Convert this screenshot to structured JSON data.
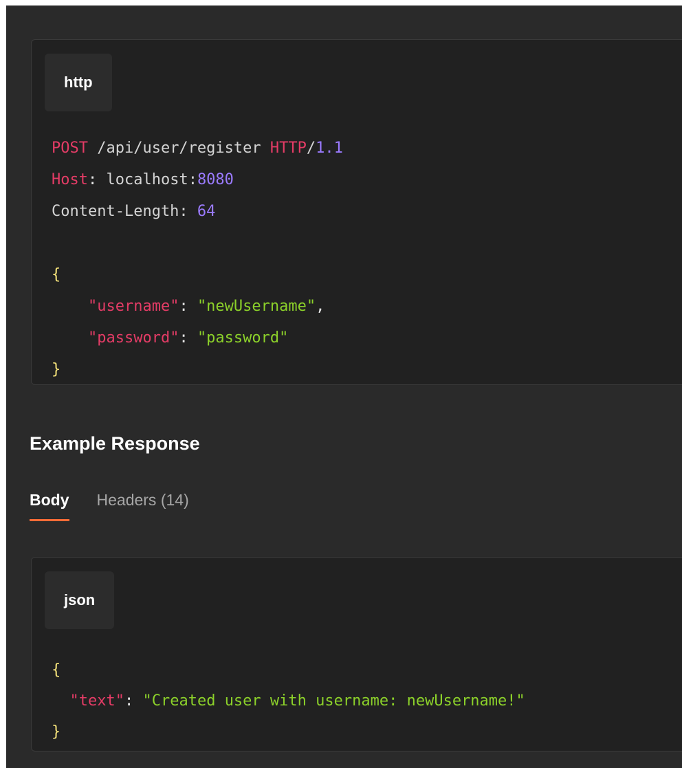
{
  "request": {
    "language": "http",
    "method": "POST",
    "path": " /api/user/register ",
    "protocol": "HTTP",
    "slash": "/",
    "version": "1.1",
    "host_key": "Host",
    "host_sep": ": ",
    "host_value": "localhost:",
    "host_port": "8080",
    "content_length_key": "Content-Length: ",
    "content_length_value": "64",
    "body": {
      "open_brace": "{",
      "close_brace": "}",
      "username_key": "\"username\"",
      "username_value": "\"newUsername\"",
      "password_key": "\"password\"",
      "password_value": "\"password\""
    }
  },
  "response": {
    "section_title": "Example Response",
    "tabs": [
      {
        "label": "Body",
        "active": true
      },
      {
        "label": "Headers (14)",
        "active": false
      }
    ],
    "language": "json",
    "body": {
      "open_brace": "{",
      "close_brace": "}",
      "text_key": "\"text\"",
      "text_value": "\"Created user with username: newUsername!\""
    }
  },
  "colors": {
    "accent": "#ff6c37",
    "keyword": "#e43c66",
    "number": "#9b7bff",
    "string": "#8cd12a",
    "background": "#2a2a2a",
    "code_background": "#212121"
  }
}
